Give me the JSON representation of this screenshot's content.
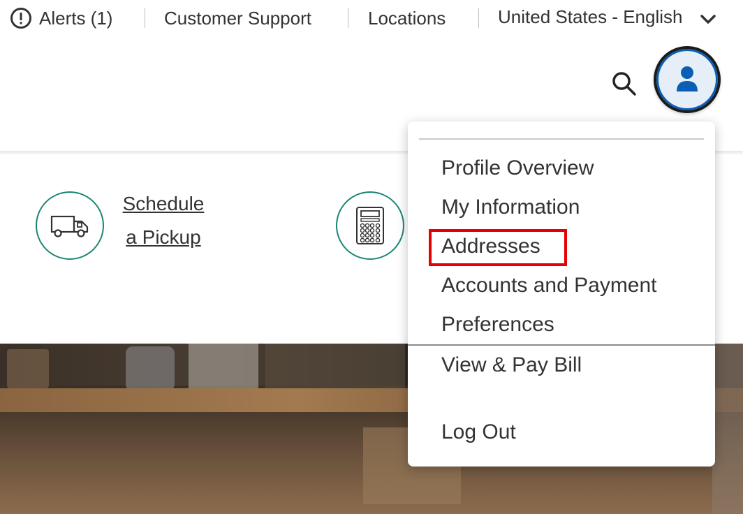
{
  "utility_bar": {
    "alerts_label": "Alerts (1)",
    "customer_support_label": "Customer Support",
    "locations_label": "Locations",
    "language_label": "United States - English"
  },
  "quick_links": {
    "schedule_pickup_line1": "Schedule",
    "schedule_pickup_line2": "a Pickup"
  },
  "account_menu": {
    "items": [
      {
        "label": "Profile Overview"
      },
      {
        "label": "My Information"
      },
      {
        "label": "Addresses"
      },
      {
        "label": "Accounts and Payment"
      },
      {
        "label": "Preferences"
      },
      {
        "label": "View & Pay Bill"
      },
      {
        "label": "Log Out"
      }
    ]
  },
  "colors": {
    "accent_teal": "#1a8574",
    "avatar_blue": "#0a5fb4",
    "highlight_red": "#e60000"
  }
}
